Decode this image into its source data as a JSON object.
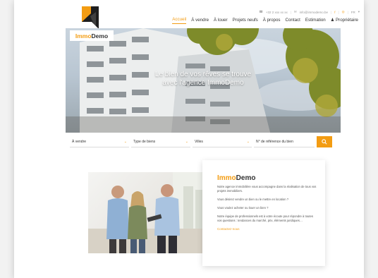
{
  "header": {
    "phone": "+32 2 xxx xx xx",
    "email": "info@immodemo.be",
    "social": [
      "f",
      "◎"
    ],
    "language": "FR",
    "brand": {
      "part1": "Immo",
      "part2": "Demo"
    },
    "nav": [
      {
        "label": "Accueil",
        "active": true
      },
      {
        "label": "À vendre",
        "active": false
      },
      {
        "label": "À louer",
        "active": false
      },
      {
        "label": "Projets neufs",
        "active": false
      },
      {
        "label": "À propos",
        "active": false
      },
      {
        "label": "Contact",
        "active": false
      },
      {
        "label": "Estimation",
        "active": false
      },
      {
        "label": "Propriétaire",
        "active": false
      }
    ]
  },
  "hero": {
    "title_line1": "Le bien de vos rêves se trouve",
    "title_line2": "avec l'agence ImmoDemo"
  },
  "search": {
    "field1": "À vendre",
    "field2": "Type de biens",
    "field3": "Villes",
    "field4": "N° de référence du bien"
  },
  "about": {
    "title_part1": "Immo",
    "title_part2": "Demo",
    "p1": "Notre agence immobilière vous accompagne dans la réalisation de tous vos projets immobiliers.",
    "p2": "Vous désirez vendre un bien ou le mettre en location ?",
    "p3": "Vous voulez acheter ou louer un bien ?",
    "p4": "Notre équipe de professionnels est à votre écoute pour répondre à toutes vos questions : tendances du marché, prix, éléments juridiques…",
    "link": "Contactez-nous"
  },
  "colors": {
    "accent": "#f39c12",
    "text": "#333333"
  }
}
